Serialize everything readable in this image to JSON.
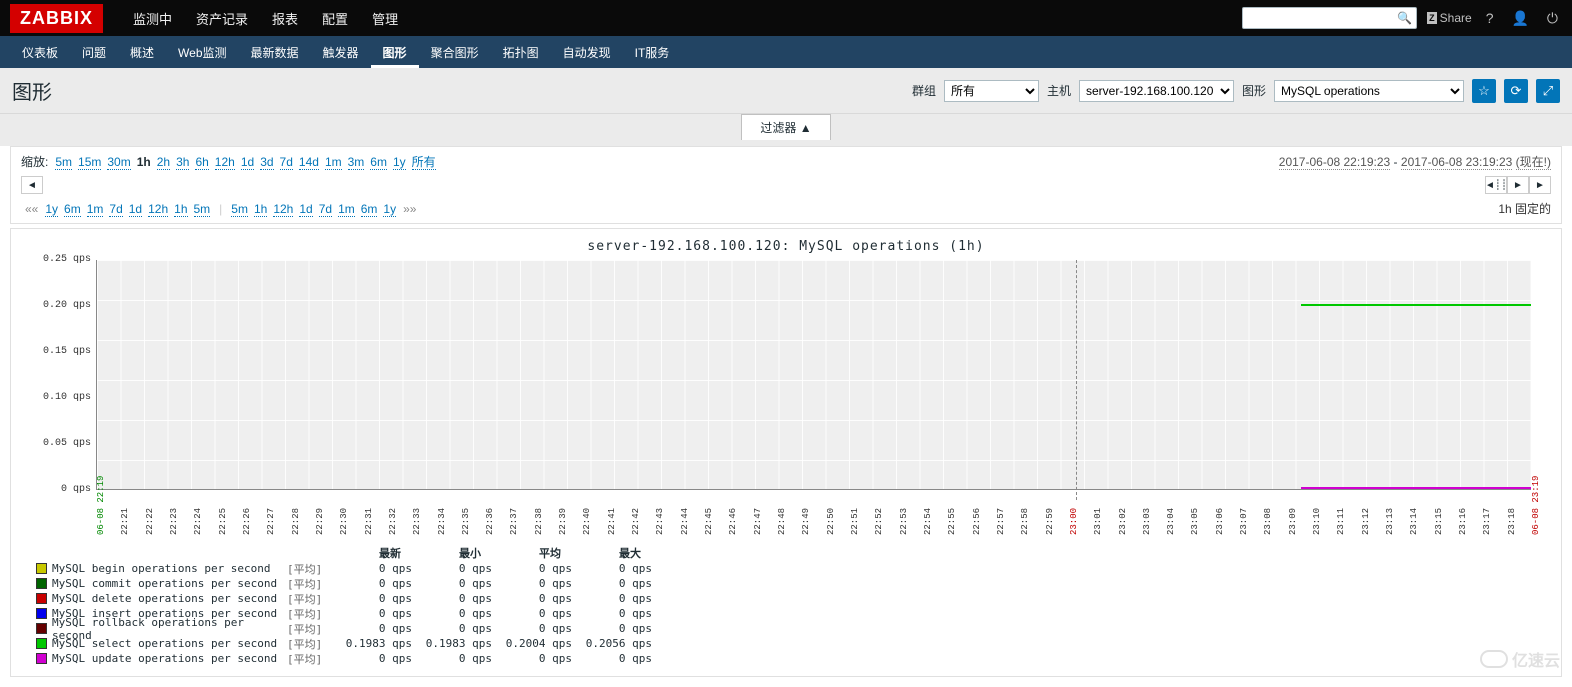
{
  "brand": "ZABBIX",
  "topnav": [
    "监测中",
    "资产记录",
    "报表",
    "配置",
    "管理"
  ],
  "topnav_active": 0,
  "share": "Share",
  "search_placeholder": "",
  "subnav": [
    "仪表板",
    "问题",
    "概述",
    "Web监测",
    "最新数据",
    "触发器",
    "图形",
    "聚合图形",
    "拓扑图",
    "自动发现",
    "IT服务"
  ],
  "subnav_active": 6,
  "page_title": "图形",
  "filter_group_label": "群组",
  "filter_group_value": "所有",
  "filter_host_label": "主机",
  "filter_host_value": "server-192.168.100.120",
  "filter_graph_label": "图形",
  "filter_graph_value": "MySQL operations",
  "filter_toggle": "过滤器 ▲",
  "zoom_label": "缩放:",
  "zoom_links": [
    "5m",
    "15m",
    "30m",
    "1h",
    "2h",
    "3h",
    "6h",
    "12h",
    "1d",
    "3d",
    "7d",
    "14d",
    "1m",
    "3m",
    "6m",
    "1y",
    "所有"
  ],
  "zoom_selected": "1h",
  "time_from": "2017-06-08 22:19:23",
  "time_to": "2017-06-08 23:19:23",
  "time_now": "(现在!)",
  "move_left": [
    "1y",
    "6m",
    "1m",
    "7d",
    "1d",
    "12h",
    "1h",
    "5m"
  ],
  "move_right": [
    "5m",
    "1h",
    "12h",
    "1d",
    "7d",
    "1m",
    "6m",
    "1y"
  ],
  "fixed_label": "1h 固定的",
  "chart_data": {
    "type": "line",
    "title": "server-192.168.100.120: MySQL operations (1h)",
    "ylabel_unit": "qps",
    "ylim": [
      0,
      0.25
    ],
    "yticks": [
      0,
      0.05,
      0.1,
      0.15,
      0.2,
      0.25
    ],
    "x_start": "2017-06-08 22:19",
    "x_end": "2017-06-08 23:19",
    "x_marker": "23:00",
    "xticks": [
      "22:19",
      "22:21",
      "22:22",
      "22:23",
      "22:24",
      "22:25",
      "22:26",
      "22:27",
      "22:28",
      "22:29",
      "22:30",
      "22:31",
      "22:32",
      "22:33",
      "22:34",
      "22:35",
      "22:36",
      "22:37",
      "22:38",
      "22:39",
      "22:40",
      "22:41",
      "22:42",
      "22:43",
      "22:44",
      "22:45",
      "22:46",
      "22:47",
      "22:48",
      "22:49",
      "22:50",
      "22:51",
      "22:52",
      "22:53",
      "22:54",
      "22:55",
      "22:56",
      "22:57",
      "22:58",
      "22:59",
      "23:00",
      "23:01",
      "23:02",
      "23:03",
      "23:04",
      "23:05",
      "23:06",
      "23:07",
      "23:08",
      "23:09",
      "23:10",
      "23:11",
      "23:12",
      "23:13",
      "23:14",
      "23:15",
      "23:16",
      "23:17",
      "23:18",
      "23:19"
    ],
    "series": [
      {
        "name": "MySQL begin operations per second",
        "color": "#c8c800",
        "agg": "[平均]",
        "last": "0 qps",
        "min": "0 qps",
        "avg": "0 qps",
        "max": "0 qps"
      },
      {
        "name": "MySQL commit operations per second",
        "color": "#006400",
        "agg": "[平均]",
        "last": "0 qps",
        "min": "0 qps",
        "avg": "0 qps",
        "max": "0 qps"
      },
      {
        "name": "MySQL delete operations per second",
        "color": "#c80000",
        "agg": "[平均]",
        "last": "0 qps",
        "min": "0 qps",
        "avg": "0 qps",
        "max": "0 qps"
      },
      {
        "name": "MySQL insert operations per second",
        "color": "#0000ee",
        "agg": "[平均]",
        "last": "0 qps",
        "min": "0 qps",
        "avg": "0 qps",
        "max": "0 qps"
      },
      {
        "name": "MySQL rollback operations per second",
        "color": "#640000",
        "agg": "[平均]",
        "last": "0 qps",
        "min": "0 qps",
        "avg": "0 qps",
        "max": "0 qps"
      },
      {
        "name": "MySQL select operations per second",
        "color": "#00c800",
        "agg": "[平均]",
        "last": "0.1983 qps",
        "min": "0.1983 qps",
        "avg": "0.2004 qps",
        "max": "0.2056 qps"
      },
      {
        "name": "MySQL update operations per second",
        "color": "#d000d0",
        "agg": "[平均]",
        "last": "0 qps",
        "min": "0 qps",
        "avg": "0 qps",
        "max": "0 qps"
      }
    ],
    "legend_headers": [
      "最新",
      "最小",
      "平均",
      "最大"
    ]
  },
  "watermark": "亿速云"
}
